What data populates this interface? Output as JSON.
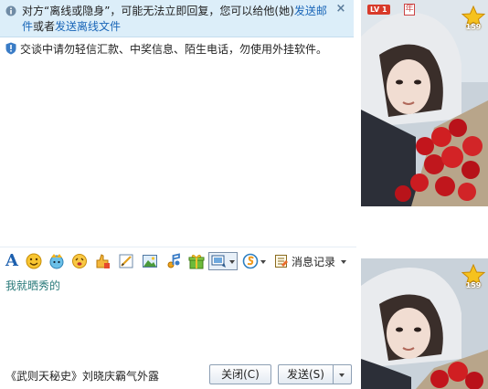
{
  "notice": {
    "text_prefix": "对方“离线或隐身”，可能无法立即回复，您可以给他(她)",
    "link_mail": "发送邮件",
    "text_or": "或者",
    "link_offline_file": "发送离线文件",
    "close": "×"
  },
  "security_tip": "交谈中请勿轻信汇款、中奖信息、陌生电话，勿使用外挂软件。",
  "profile": {
    "level": "LV 1",
    "year_badge": "年",
    "star_count": "159"
  },
  "toolbar": {
    "font_label": "A",
    "history_label": "消息记录"
  },
  "input": {
    "value": "我就晒秀的"
  },
  "footer": {
    "news_text": "《武则天秘史》刘晓庆霸气外露",
    "close_label": "关闭(C)",
    "send_label": "发送(S)"
  },
  "colors": {
    "notice_bg": "#dceef9",
    "link": "#1a66b8",
    "input_text": "#2a7a7a",
    "accent": "#1c5fae"
  }
}
